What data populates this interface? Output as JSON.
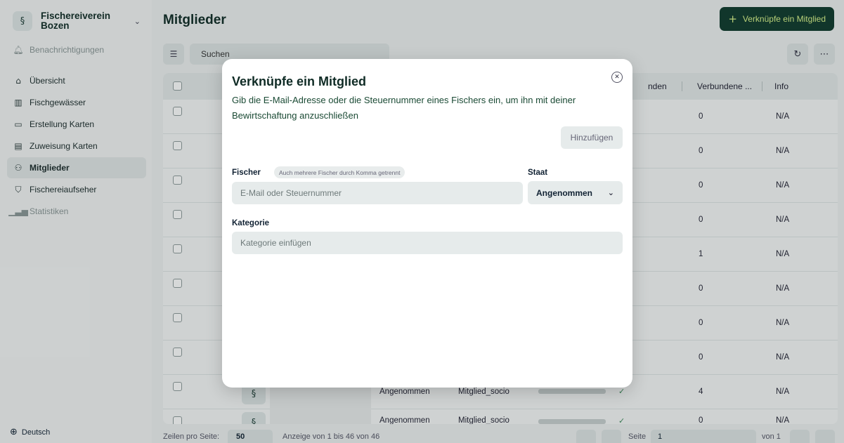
{
  "sidebar": {
    "org_name": "Fischereiverein Bozen",
    "notifications": "Benachrichtigungen",
    "items": [
      {
        "label": "Übersicht",
        "icon": "home-icon"
      },
      {
        "label": "Fischgewässer",
        "icon": "map-icon"
      },
      {
        "label": "Erstellung Karten",
        "icon": "card-create-icon"
      },
      {
        "label": "Zuweisung Karten",
        "icon": "card-assign-icon"
      },
      {
        "label": "Mitglieder",
        "icon": "members-icon",
        "active": true
      },
      {
        "label": "Fischereiaufseher",
        "icon": "shield-icon"
      },
      {
        "label": "Statistiken",
        "icon": "chart-icon",
        "muted": true
      }
    ],
    "language": "Deutsch"
  },
  "header": {
    "title": "Mitglieder",
    "primary_button": "Verknüpfe ein Mitglied"
  },
  "toolbar": {
    "search_placeholder": "Suchen"
  },
  "table": {
    "columns": [
      "nden",
      "Verbundene ...",
      "Info"
    ],
    "rows": [
      {
        "connected": "0",
        "info": "N/A"
      },
      {
        "connected": "0",
        "info": "N/A"
      },
      {
        "connected": "0",
        "info": "N/A"
      },
      {
        "connected": "0",
        "info": "N/A"
      },
      {
        "connected": "1",
        "info": "N/A"
      },
      {
        "connected": "0",
        "info": "N/A"
      },
      {
        "connected": "0",
        "info": "N/A"
      },
      {
        "connected": "0",
        "info": "N/A"
      },
      {
        "status": "Angenommen",
        "category": "Mitglied_socio",
        "connected": "4",
        "info": "N/A"
      },
      {
        "status": "Angenommen",
        "category": "Mitglied_socio",
        "connected": "0",
        "info": "N/A"
      }
    ]
  },
  "footer": {
    "rows_per_page_label": "Zeilen pro Seite:",
    "rows_per_page_value": "50",
    "range_text": "Anzeige von 1 bis 46 von 46",
    "page_label": "Seite",
    "page_value": "1",
    "of_text": "von 1"
  },
  "modal": {
    "title": "Verknüpfe ein Mitglied",
    "subtitle": "Gib die E-Mail-Adresse oder die Steuernummer eines Fischers ein, um ihn mit deiner Bewirtschaftung anzuschließen",
    "add_button": "Hinzufügen",
    "fischer_label": "Fischer",
    "fischer_hint": "Auch mehrere Fischer durch Komma getrennt",
    "fischer_placeholder": "E-Mail oder Steuernummer",
    "staat_label": "Staat",
    "staat_value": "Angenommen",
    "kategorie_label": "Kategorie",
    "kategorie_placeholder": "Kategorie einfügen"
  }
}
